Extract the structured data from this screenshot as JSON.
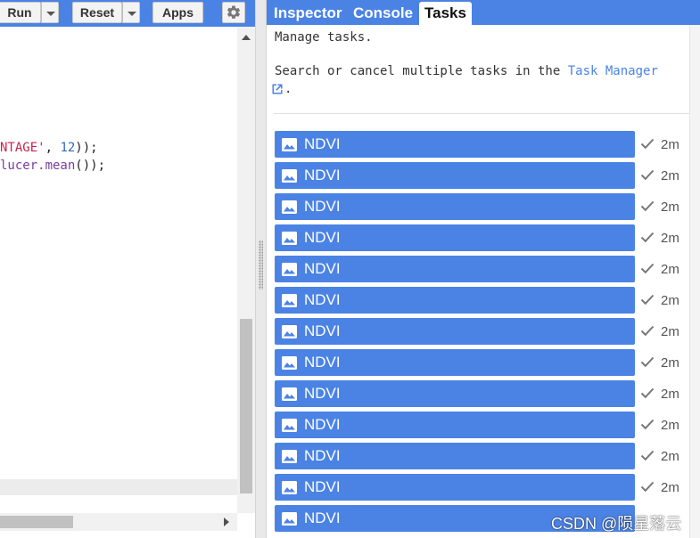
{
  "toolbar": {
    "run_label": "Run",
    "reset_label": "Reset",
    "apps_label": "Apps",
    "settings_icon": "gear-icon"
  },
  "code_editor": {
    "lines": [
      {
        "str": "NTAGE'",
        "punct1": ", ",
        "num": "12",
        "punct2": "));"
      },
      {
        "fn": "lucer.mean",
        "punct": "());"
      }
    ]
  },
  "tabs": [
    {
      "label": "Inspector",
      "active": false
    },
    {
      "label": "Console",
      "active": false
    },
    {
      "label": "Tasks",
      "active": true
    }
  ],
  "tasks_panel": {
    "manage_text": "Manage tasks.",
    "search_prefix": "Search or cancel multiple tasks in the ",
    "search_link": "Task Manager",
    "search_suffix": ".",
    "link_icon": "open-in-new-icon",
    "task_icon": "image-icon",
    "status_icon": "check-icon",
    "tasks": [
      {
        "name": "NDVI",
        "time": "2m"
      },
      {
        "name": "NDVI",
        "time": "2m"
      },
      {
        "name": "NDVI",
        "time": "2m"
      },
      {
        "name": "NDVI",
        "time": "2m"
      },
      {
        "name": "NDVI",
        "time": "2m"
      },
      {
        "name": "NDVI",
        "time": "2m"
      },
      {
        "name": "NDVI",
        "time": "2m"
      },
      {
        "name": "NDVI",
        "time": "2m"
      },
      {
        "name": "NDVI",
        "time": "2m"
      },
      {
        "name": "NDVI",
        "time": "2m"
      },
      {
        "name": "NDVI",
        "time": "2m"
      },
      {
        "name": "NDVI",
        "time": "2m"
      },
      {
        "name": "NDVI",
        "time": ""
      }
    ]
  },
  "watermark": "CSDN @陨星落云",
  "colors": {
    "accent": "#4b83e5",
    "string": "#c7254e",
    "number": "#3869b8",
    "function": "#7a3e9d"
  }
}
